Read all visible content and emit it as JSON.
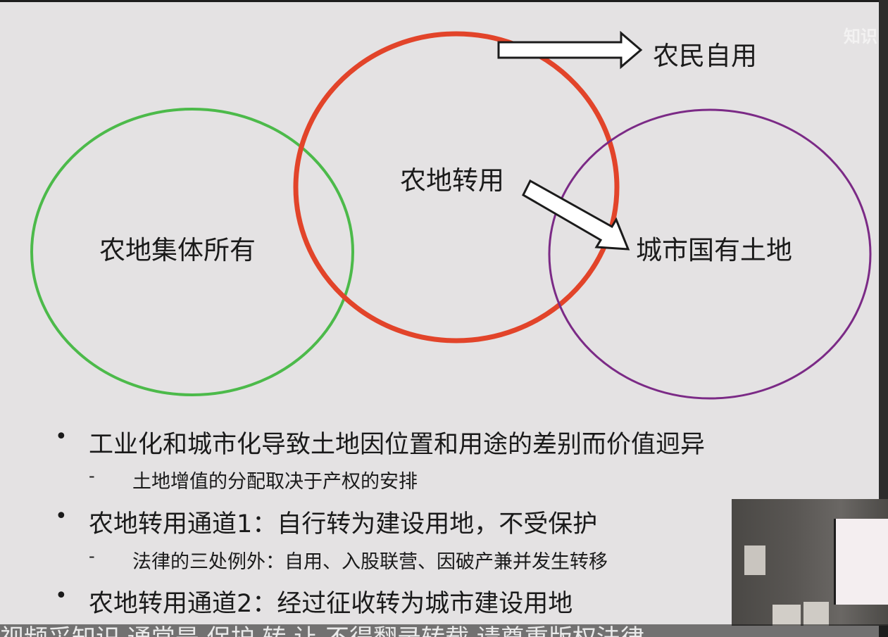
{
  "watermark": "知识",
  "diagram": {
    "circle_left_label": "农地集体所有",
    "circle_middle_label": "农地转用",
    "circle_right_label": "城市国有土地",
    "arrow_top_label": "农民自用",
    "colors": {
      "green_circle": "#4cba4a",
      "red_circle": "#e2442a",
      "purple_circle": "#7b2a86",
      "slide_background": "#e4e2e3"
    }
  },
  "bullets": [
    {
      "level": 1,
      "marker": "•",
      "text": "工业化和城市化导致土地因位置和用途的差别而价值迥异"
    },
    {
      "level": 2,
      "marker": "-",
      "text": "土地增值的分配取决于产权的安排"
    },
    {
      "level": 1,
      "marker": "•",
      "text": "农地转用通道1：自行转为建设用地，不受保护"
    },
    {
      "level": 2,
      "marker": "-",
      "text": "法律的三处例外：自用、入股联营、因破产兼并发生转移"
    },
    {
      "level": 1,
      "marker": "•",
      "text": "农地转用通道2：经过征收转为城市建设用地"
    }
  ],
  "caption": "视频采知识 通常是 保护 转 让 不得翻录转载 请尊重版权法律"
}
